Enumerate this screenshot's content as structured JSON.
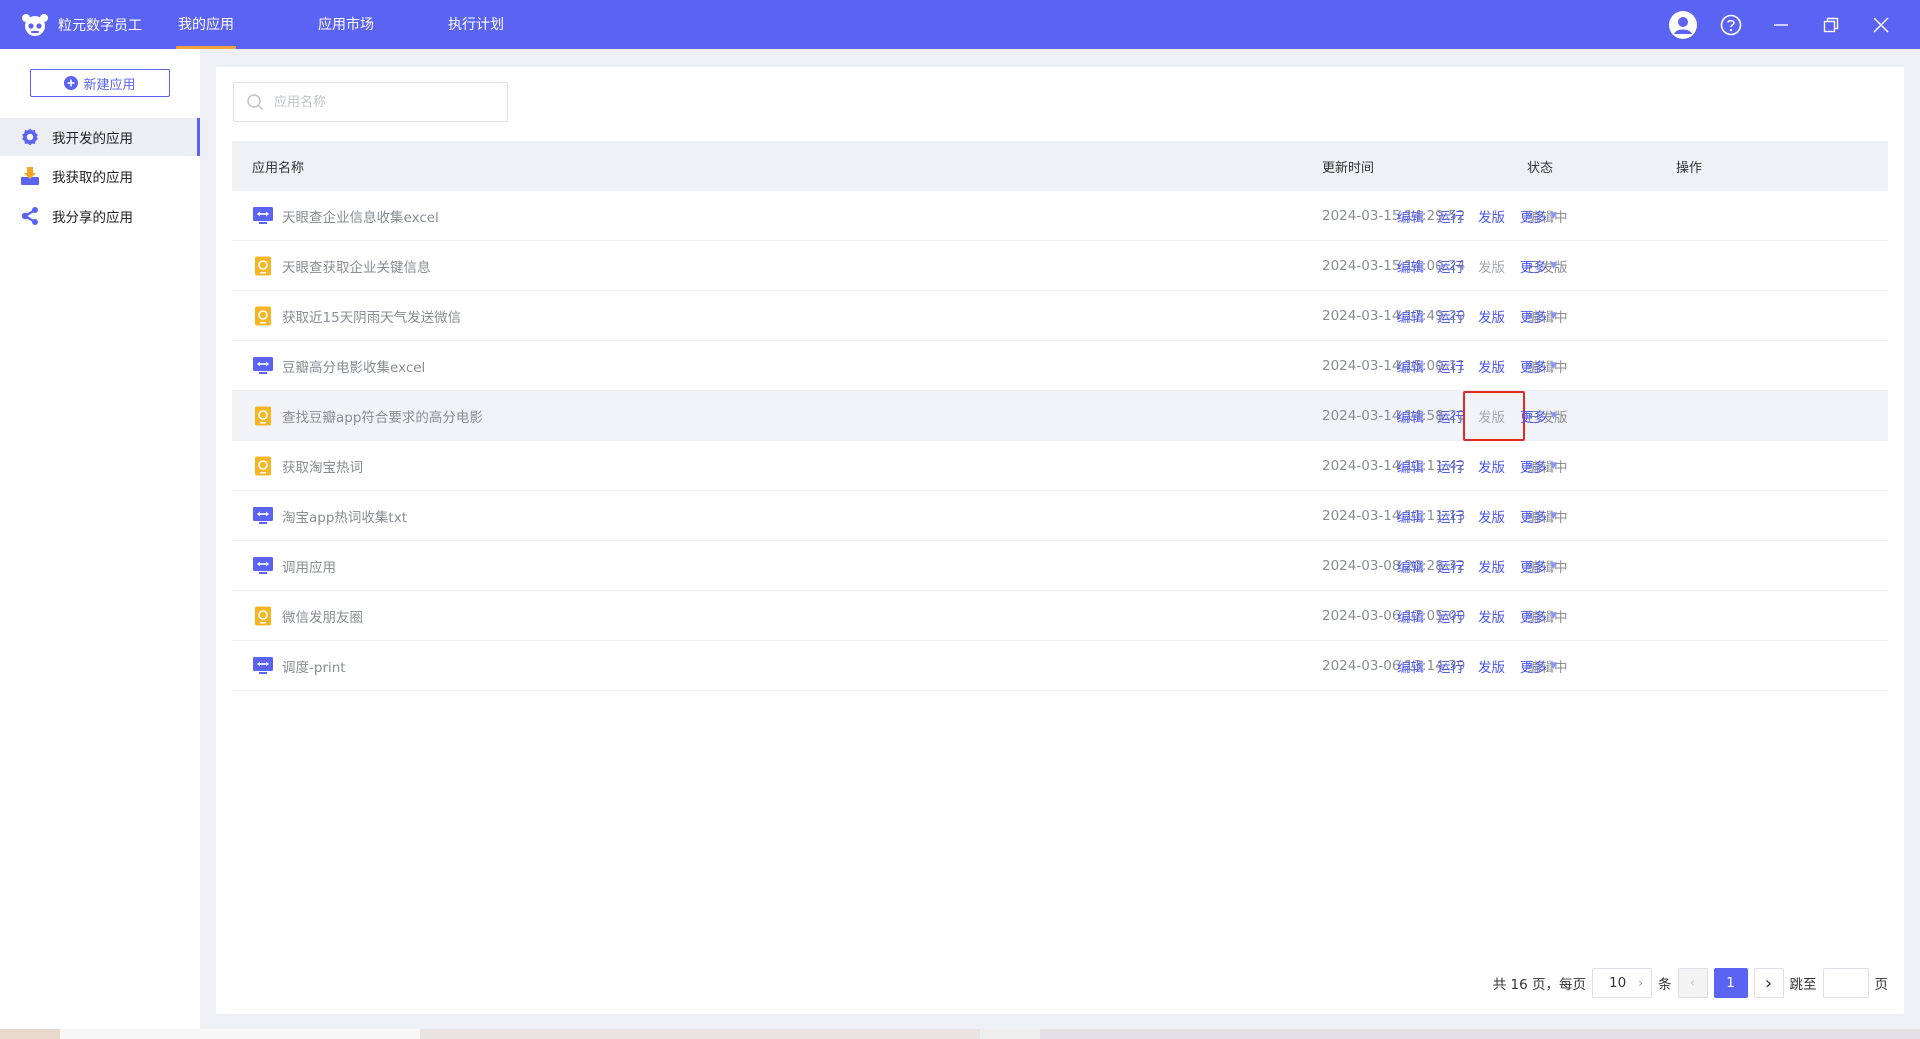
{
  "topbar": {
    "brand_name": "粒元数字员工",
    "tabs": [
      {
        "label": "我的应用",
        "active": true
      },
      {
        "label": "应用市场",
        "active": false
      },
      {
        "label": "执行计划",
        "active": false
      }
    ],
    "accent_color": "#5b63f2"
  },
  "sidebar": {
    "new_app_label": "新建应用",
    "items": [
      {
        "label": "我开发的应用",
        "icon": "gear-icon",
        "active": true
      },
      {
        "label": "我获取的应用",
        "icon": "download-icon",
        "active": false
      },
      {
        "label": "我分享的应用",
        "icon": "share-icon",
        "active": false
      }
    ]
  },
  "search": {
    "placeholder": "应用名称",
    "value": ""
  },
  "table": {
    "columns": [
      "应用名称",
      "更新时间",
      "状态",
      "操作"
    ],
    "rows": [
      {
        "name": "天眼查企业信息收集excel",
        "icon": "desktop-app-icon",
        "time": "2024-03-15 14:29:52",
        "status": "编辑中",
        "publish_enabled": true
      },
      {
        "name": "天眼查获取企业关键信息",
        "icon": "mobile-app-icon",
        "time": "2024-03-15 14:00:24",
        "status": "已发版",
        "publish_enabled": false
      },
      {
        "name": "获取近15天阴雨天气发送微信",
        "icon": "mobile-app-icon",
        "time": "2024-03-14 17:49:20",
        "status": "编辑中",
        "publish_enabled": true
      },
      {
        "name": "豆瓣高分电影收集excel",
        "icon": "desktop-app-icon",
        "time": "2024-03-14 15:00:11",
        "status": "编辑中",
        "publish_enabled": true
      },
      {
        "name": "查找豆瓣app符合要求的高分电影",
        "icon": "mobile-app-icon",
        "time": "2024-03-14 14:58:20",
        "status": "已发版",
        "publish_enabled": false,
        "highlighted": true
      },
      {
        "name": "获取淘宝热词",
        "icon": "mobile-app-icon",
        "time": "2024-03-14 11:11:42",
        "status": "编辑中",
        "publish_enabled": true
      },
      {
        "name": "淘宝app热词收集txt",
        "icon": "desktop-app-icon",
        "time": "2024-03-14 11:11:13",
        "status": "编辑中",
        "publish_enabled": true
      },
      {
        "name": "调用应用",
        "icon": "desktop-app-icon",
        "time": "2024-03-08 20:28:32",
        "status": "编辑中",
        "publish_enabled": true
      },
      {
        "name": "微信发朋友圈",
        "icon": "mobile-app-icon",
        "time": "2024-03-06 17:05:00",
        "status": "编辑中",
        "publish_enabled": true
      },
      {
        "name": "调度-print",
        "icon": "desktop-app-icon",
        "time": "2024-03-06 13:14:39",
        "status": "编辑中",
        "publish_enabled": true
      }
    ],
    "ops": {
      "edit": "编辑",
      "run": "运行",
      "publish": "发版",
      "more": "更多"
    }
  },
  "pagination": {
    "total_text": "共 16 页，每页",
    "page_size": "10",
    "unit": "条",
    "current_page": "1",
    "jump_label": "跳至",
    "page_suffix": "页"
  },
  "colors": {
    "link": "#4b57f0",
    "highlight_border": "#e02a2a",
    "mobile_icon": "#f6b622",
    "desktop_icon": "#5b63f2"
  }
}
